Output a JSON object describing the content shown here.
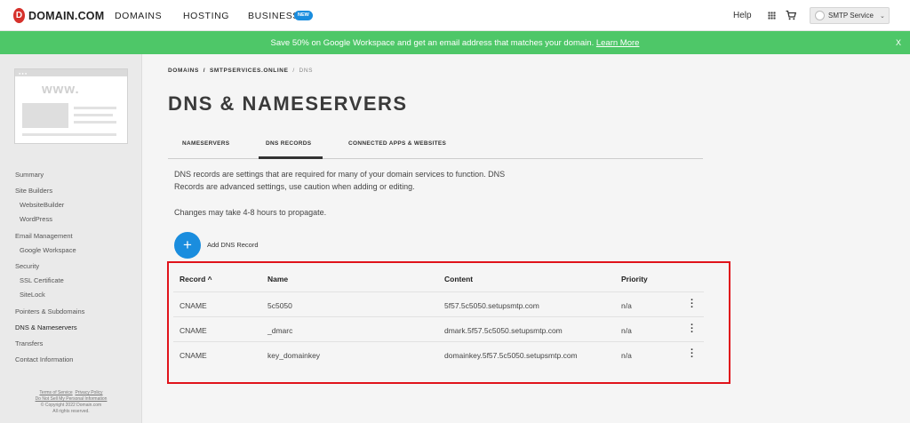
{
  "brand": {
    "logo_letter": "D",
    "name": "DOMAIN.COM"
  },
  "nav": {
    "domains": "DOMAINS",
    "hosting": "HOSTING",
    "business": "BUSINESS",
    "business_badge": "NEW",
    "help": "Help",
    "grid_icon": "apps-grid-icon",
    "cart_icon": "cart-icon",
    "account_name": "SMTP Service",
    "account_chevron": "⌄"
  },
  "banner": {
    "text": "Save 50% on Google Workspace and get an email address that matches your domain.",
    "link": "Learn More",
    "close": "X",
    "color": "#4ec768"
  },
  "sidebar": {
    "thumb_text": "www.",
    "items": [
      {
        "label": "Summary"
      },
      {
        "label": "Site Builders"
      },
      {
        "label": "WebsiteBuilder"
      },
      {
        "label": "WordPress"
      },
      {
        "label": "Email Management"
      },
      {
        "label": "Google Workspace"
      },
      {
        "label": "Security"
      },
      {
        "label": "SSL Certificate"
      },
      {
        "label": "SiteLock"
      },
      {
        "label": "Pointers & Subdomains"
      },
      {
        "label": "DNS & Nameservers"
      },
      {
        "label": "Transfers"
      },
      {
        "label": "Contact Information"
      }
    ],
    "footer": {
      "terms": "Terms of Service",
      "privacy": "Privacy Policy",
      "do_not_sell": "Do Not Sell My Personal Information",
      "copyright": "© Copyright 2022 Domain.com",
      "rights": "All rights reserved."
    }
  },
  "breadcrumb": {
    "domains": "DOMAINS",
    "sep": "/",
    "domain": "SMTPSERVICES.ONLINE",
    "current": "DNS"
  },
  "page_title": "DNS & NAMESERVERS",
  "tabs": {
    "nameservers": "NAMESERVERS",
    "dns_records": "DNS RECORDS",
    "connected": "CONNECTED APPS & WEBSITES",
    "active": "DNS RECORDS"
  },
  "description": {
    "line1": "DNS records are settings that are required for many of your domain services to function. DNS",
    "line2": "Records are advanced settings, use caution when adding or editing.",
    "line3": "Changes may take 4-8 hours to propagate."
  },
  "add_record": {
    "icon": "+",
    "label": "Add DNS Record",
    "color": "#1a8dde"
  },
  "table": {
    "headers": {
      "record": "Record",
      "record_sort": "^",
      "name": "Name",
      "content": "Content",
      "priority": "Priority"
    },
    "rows": [
      {
        "record": "CNAME",
        "name": "5c5050",
        "content": "5f57.5c5050.setupsmtp.com",
        "priority": "n/a"
      },
      {
        "record": "CNAME",
        "name": "_dmarc",
        "content": "dmark.5f57.5c5050.setupsmtp.com",
        "priority": "n/a"
      },
      {
        "record": "CNAME",
        "name": "key_domainkey",
        "content": "domainkey.5f57.5c5050.setupsmtp.com",
        "priority": "n/a"
      }
    ],
    "highlight_color": "#e0131b"
  }
}
